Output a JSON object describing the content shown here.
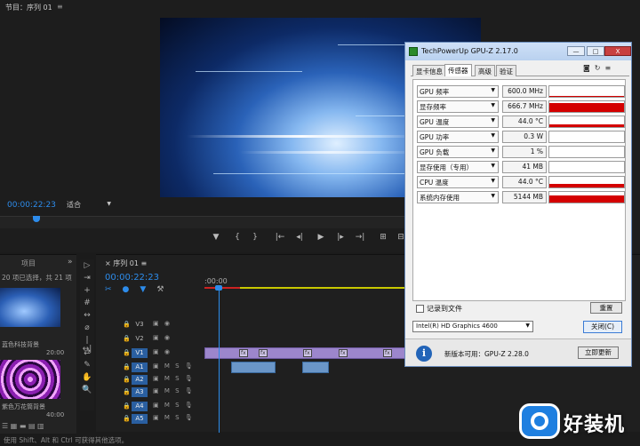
{
  "program_monitor": {
    "title": "节目：序列 01",
    "menu_icon": "≡",
    "timecode": "00:00:22:23",
    "fit_label": "适合",
    "transport_icons": [
      "marker",
      "in-point",
      "out-point",
      "go-to-in",
      "step-back",
      "play",
      "step-forward",
      "go-to-out",
      "insert",
      "overwrite"
    ]
  },
  "project": {
    "tab": "项目",
    "more": "»",
    "selection": "20 项已选择，共 21 项",
    "clips": [
      {
        "name": "蓝色科技背景",
        "duration": "20:00"
      },
      {
        "name": "紫色万花筒背景",
        "duration": "40:00"
      }
    ]
  },
  "timeline": {
    "tab": "序列 01",
    "timecode": "00:00:22:23",
    "ruler_start": ":00:00",
    "video_tracks": [
      "V3",
      "V2",
      "V1"
    ],
    "audio_tracks": [
      "A1",
      "A2",
      "A3",
      "A4",
      "A5"
    ],
    "track_ctl_labels": {
      "mute": "M",
      "solo": "S"
    }
  },
  "status": {
    "text": "使用 Shift、Alt 和 Ctrl 可获得其他选项。"
  },
  "gpuz": {
    "title": "TechPowerUp GPU-Z 2.17.0",
    "window_buttons": {
      "min": "—",
      "max": "□",
      "close": "X"
    },
    "tabs": [
      "显卡信息",
      "传感器",
      "高级",
      "验证"
    ],
    "active_tab": "传感器",
    "sensors": [
      {
        "label": "GPU 频率",
        "value": "600.0 MHz",
        "level": 0.05
      },
      {
        "label": "显存频率",
        "value": "666.7 MHz",
        "level": 0.85
      },
      {
        "label": "GPU 温度",
        "value": "44.0 °C",
        "level": 0.25
      },
      {
        "label": "GPU 功率",
        "value": "0.3 W",
        "level": 0.0
      },
      {
        "label": "GPU 负载",
        "value": "1 %",
        "level": 0.0
      },
      {
        "label": "显存使用（专用）",
        "value": "41 MB",
        "level": 0.0
      },
      {
        "label": "CPU 温度",
        "value": "44.0 °C",
        "level": 0.3
      },
      {
        "label": "系统内存使用",
        "value": "5144 MB",
        "level": 0.7
      }
    ],
    "log_label": "记录到文件",
    "reset_label": "重置",
    "gpu_name": "Intel(R) HD Graphics 4600",
    "close_label": "关闭(C)",
    "update_text": "新版本可用：GPU-Z 2.28.0",
    "update_button": "立即更新",
    "accent": "#d40000"
  },
  "watermark": {
    "text": "好装机"
  }
}
